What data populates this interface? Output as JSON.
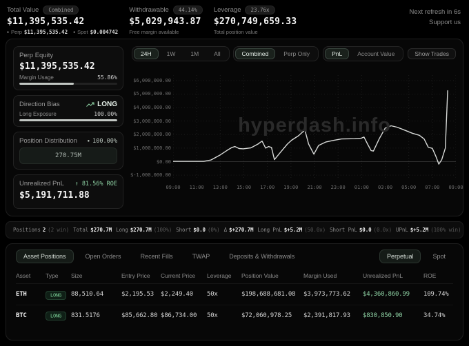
{
  "topbar": {
    "stats": [
      {
        "id": "total-value",
        "label": "Total Value",
        "badge": "Combined",
        "value": "$11,395,535.42",
        "sub_items": [
          {
            "label": "Perp",
            "value": "$11,395,535.42"
          },
          {
            "label": "Spot",
            "value": "$0.004742"
          }
        ]
      },
      {
        "id": "withdrawable",
        "label": "Withdrawable",
        "badge": "44.14%",
        "value": "$5,029,943.87",
        "sub_text": "Free margin available"
      },
      {
        "id": "leverage",
        "label": "Leverage",
        "badge": "23.76x",
        "value": "$270,749,659.33",
        "sub_text": "Total position value"
      }
    ],
    "refresh_text": "Next refresh in 6s",
    "support_text": "Support us"
  },
  "icons": {
    "bullet": "●",
    "up_arrow": "↑"
  },
  "sidebar": {
    "perp_equity": {
      "label": "Perp Equity",
      "value": "$11,395,535.42",
      "usage_label": "Margin Usage",
      "usage_value": "55.86%",
      "usage_pct": 55.86
    },
    "direction_bias": {
      "label": "Direction Bias",
      "value": "LONG",
      "exposure_label": "Long Exposure",
      "exposure_value": "100.00%",
      "exposure_pct": 100
    },
    "position_distribution": {
      "label": "Position Distribution",
      "pct_value": "100.00%",
      "bar_label": "270.75M",
      "bar_pct": 100
    },
    "unrealized_pnl": {
      "label": "Unrealized PnL",
      "roe_value": "81.56% ROE",
      "value": "$5,191,711.88"
    }
  },
  "chart": {
    "range_tabs": [
      {
        "label": "24H",
        "active": true
      },
      {
        "label": "1W",
        "active": false
      },
      {
        "label": "1M",
        "active": false
      },
      {
        "label": "All",
        "active": false
      }
    ],
    "source_tabs": [
      {
        "label": "Combined",
        "active": true
      },
      {
        "label": "Perp Only",
        "active": false
      }
    ],
    "metric_tabs": [
      {
        "label": "PnL",
        "active": true
      },
      {
        "label": "Account Value",
        "active": false
      }
    ],
    "show_trades_label": "Show Trades",
    "watermark": "hyperdash.info",
    "chart_data": {
      "type": "line",
      "title": "24H PnL (Combined)",
      "xlabel": "",
      "ylabel": "",
      "x_unit": "hours from 09:00",
      "xlim": [
        0,
        24
      ],
      "ylim": [
        -1.35,
        6.4
      ],
      "y_unit": "millions USD",
      "grid": true,
      "legend_position": "none",
      "line_color": "#d8dad8",
      "grid_color": "#1d1d1d",
      "zero_line_color": "#303030",
      "yticks": [
        {
          "label": "$6,000,000.00",
          "value": 6
        },
        {
          "label": "$5,000,000.00",
          "value": 5
        },
        {
          "label": "$4,000,000.00",
          "value": 4
        },
        {
          "label": "$3,000,000.00",
          "value": 3
        },
        {
          "label": "$2,000,000.00",
          "value": 2
        },
        {
          "label": "$1,000,000.00",
          "value": 1
        },
        {
          "label": "$0.00",
          "value": 0
        },
        {
          "label": "$-1,000,000.00",
          "value": -1
        }
      ],
      "xticks": [
        "09:00",
        "11:00",
        "13:00",
        "15:00",
        "17:00",
        "19:00",
        "21:00",
        "23:00",
        "01:00",
        "03:00",
        "05:00",
        "07:00",
        "09:00"
      ],
      "points": [
        [
          0,
          0.02
        ],
        [
          1.5,
          0.02
        ],
        [
          2.6,
          0.02
        ],
        [
          3.2,
          0.12
        ],
        [
          4.0,
          0.5
        ],
        [
          4.6,
          0.85
        ],
        [
          5.0,
          1.05
        ],
        [
          5.25,
          1.12
        ],
        [
          5.6,
          0.97
        ],
        [
          5.95,
          0.95
        ],
        [
          6.6,
          1.02
        ],
        [
          7.2,
          1.3
        ],
        [
          7.55,
          1.52
        ],
        [
          7.85,
          1.0
        ],
        [
          8.1,
          1.12
        ],
        [
          8.35,
          1.05
        ],
        [
          8.6,
          0.15
        ],
        [
          9.1,
          0.68
        ],
        [
          9.7,
          1.3
        ],
        [
          10.05,
          1.58
        ],
        [
          10.65,
          1.92
        ],
        [
          11.0,
          2.2
        ],
        [
          11.2,
          2.28
        ],
        [
          11.5,
          1.3
        ],
        [
          11.95,
          0.55
        ],
        [
          12.35,
          1.2
        ],
        [
          12.95,
          1.45
        ],
        [
          13.6,
          1.57
        ],
        [
          14.3,
          1.68
        ],
        [
          15.4,
          1.7
        ],
        [
          15.95,
          1.73
        ],
        [
          16.2,
          1.82
        ],
        [
          16.5,
          1.3
        ],
        [
          16.8,
          0.82
        ],
        [
          17.0,
          0.78
        ],
        [
          17.5,
          1.7
        ],
        [
          18.0,
          2.48
        ],
        [
          18.5,
          2.65
        ],
        [
          19.0,
          2.55
        ],
        [
          19.5,
          2.38
        ],
        [
          20.3,
          2.1
        ],
        [
          20.9,
          1.95
        ],
        [
          21.3,
          1.68
        ],
        [
          21.65,
          1.07
        ],
        [
          22.0,
          0.98
        ],
        [
          22.3,
          0.4
        ],
        [
          22.55,
          -0.18
        ],
        [
          22.8,
          0.15
        ],
        [
          23.1,
          1.0
        ],
        [
          23.3,
          5.25
        ]
      ]
    }
  },
  "summary": {
    "items": [
      {
        "label": "Positions",
        "value": "2",
        "extra": "(2 win)"
      },
      {
        "label": "Total",
        "value": "$270.7M",
        "extra": ""
      },
      {
        "label": "Long",
        "value": "$270.7M",
        "extra": "(100%)"
      },
      {
        "label": "Short",
        "value": "$0.0",
        "extra": "(0%)"
      },
      {
        "label": "Δ",
        "value": "$+270.7M",
        "extra": ""
      },
      {
        "label": "Long PnL",
        "value": "$+5.2M",
        "extra": "(50.0x)"
      },
      {
        "label": "Short PnL",
        "value": "$0.0",
        "extra": "(0.0x)"
      },
      {
        "label": "UPnL",
        "value": "$+5.2M",
        "extra": "(100% win)"
      }
    ]
  },
  "positions": {
    "tabs": [
      {
        "label": "Asset Positions",
        "active": true
      },
      {
        "label": "Open Orders",
        "active": false
      },
      {
        "label": "Recent Fills",
        "active": false
      },
      {
        "label": "TWAP",
        "active": false
      },
      {
        "label": "Deposits & Withdrawals",
        "active": false
      }
    ],
    "market_tabs": [
      {
        "label": "Perpetual",
        "active": true
      },
      {
        "label": "Spot",
        "active": false
      }
    ],
    "table": {
      "headers": [
        "Asset",
        "Type",
        "Size",
        "Entry Price",
        "Current Price",
        "Leverage",
        "Position Value",
        "Margin Used",
        "Unrealized PnL",
        "ROE"
      ],
      "rows": [
        {
          "asset": "ETH",
          "type": "LONG",
          "size": "88,510.64",
          "entry_price": "$2,195.53",
          "current_price": "$2,249.40",
          "leverage": "50x",
          "position_value": "$198,688,681.08",
          "margin_used": "$3,973,773.62",
          "unrealized_pnl": "$4,360,860.99",
          "roe": "109.74%"
        },
        {
          "asset": "BTC",
          "type": "LONG",
          "size": "831.5176",
          "entry_price": "$85,662.80",
          "current_price": "$86,734.00",
          "leverage": "50x",
          "position_value": "$72,060,978.25",
          "margin_used": "$2,391,817.93",
          "unrealized_pnl": "$830,850.90",
          "roe": "34.74%"
        }
      ]
    }
  },
  "colors": {
    "accent_green": "#8fd3a5",
    "line": "#d8dad8",
    "panel_border": "#1e1e1e"
  }
}
